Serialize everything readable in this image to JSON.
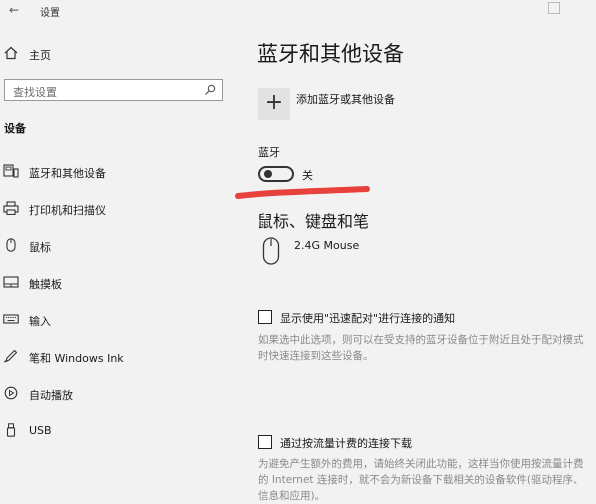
{
  "window": {
    "title": "设置"
  },
  "sidebar": {
    "home_label": "主页",
    "search_placeholder": "查找设置",
    "section_title": "设备",
    "items": [
      {
        "label": "蓝牙和其他设备",
        "icon": "bluetooth-devices-icon"
      },
      {
        "label": "打印机和扫描仪",
        "icon": "printer-icon"
      },
      {
        "label": "鼠标",
        "icon": "mouse-icon"
      },
      {
        "label": "触摸板",
        "icon": "touchpad-icon"
      },
      {
        "label": "输入",
        "icon": "keyboard-icon"
      },
      {
        "label": "笔和 Windows Ink",
        "icon": "pen-icon"
      },
      {
        "label": "自动播放",
        "icon": "autoplay-icon"
      },
      {
        "label": "USB",
        "icon": "usb-icon"
      }
    ]
  },
  "main": {
    "title": "蓝牙和其他设备",
    "add_device_label": "添加蓝牙或其他设备",
    "bluetooth": {
      "label": "蓝牙",
      "state": "关",
      "on": false
    },
    "mouse_section": {
      "title": "鼠标、键盘和笔",
      "devices": [
        {
          "name": "2.4G Mouse"
        }
      ]
    },
    "swift_pair": {
      "label": "显示使用\"迅速配对\"进行连接的通知",
      "checked": false,
      "description": "如果选中此选项，则可以在受支持的蓝牙设备位于附近且处于配对模式时快速连接到这些设备。"
    },
    "metered": {
      "label": "通过按流量计费的连接下载",
      "checked": false,
      "description": "为避免产生额外的费用，请始终关闭此功能，这样当你使用按流量计费的 Internet 连接时，就不会为新设备下载相关的设备软件(驱动程序、信息和应用)。"
    }
  },
  "colors": {
    "accent_annotation": "#e8413c",
    "background": "#f2f2f2"
  }
}
